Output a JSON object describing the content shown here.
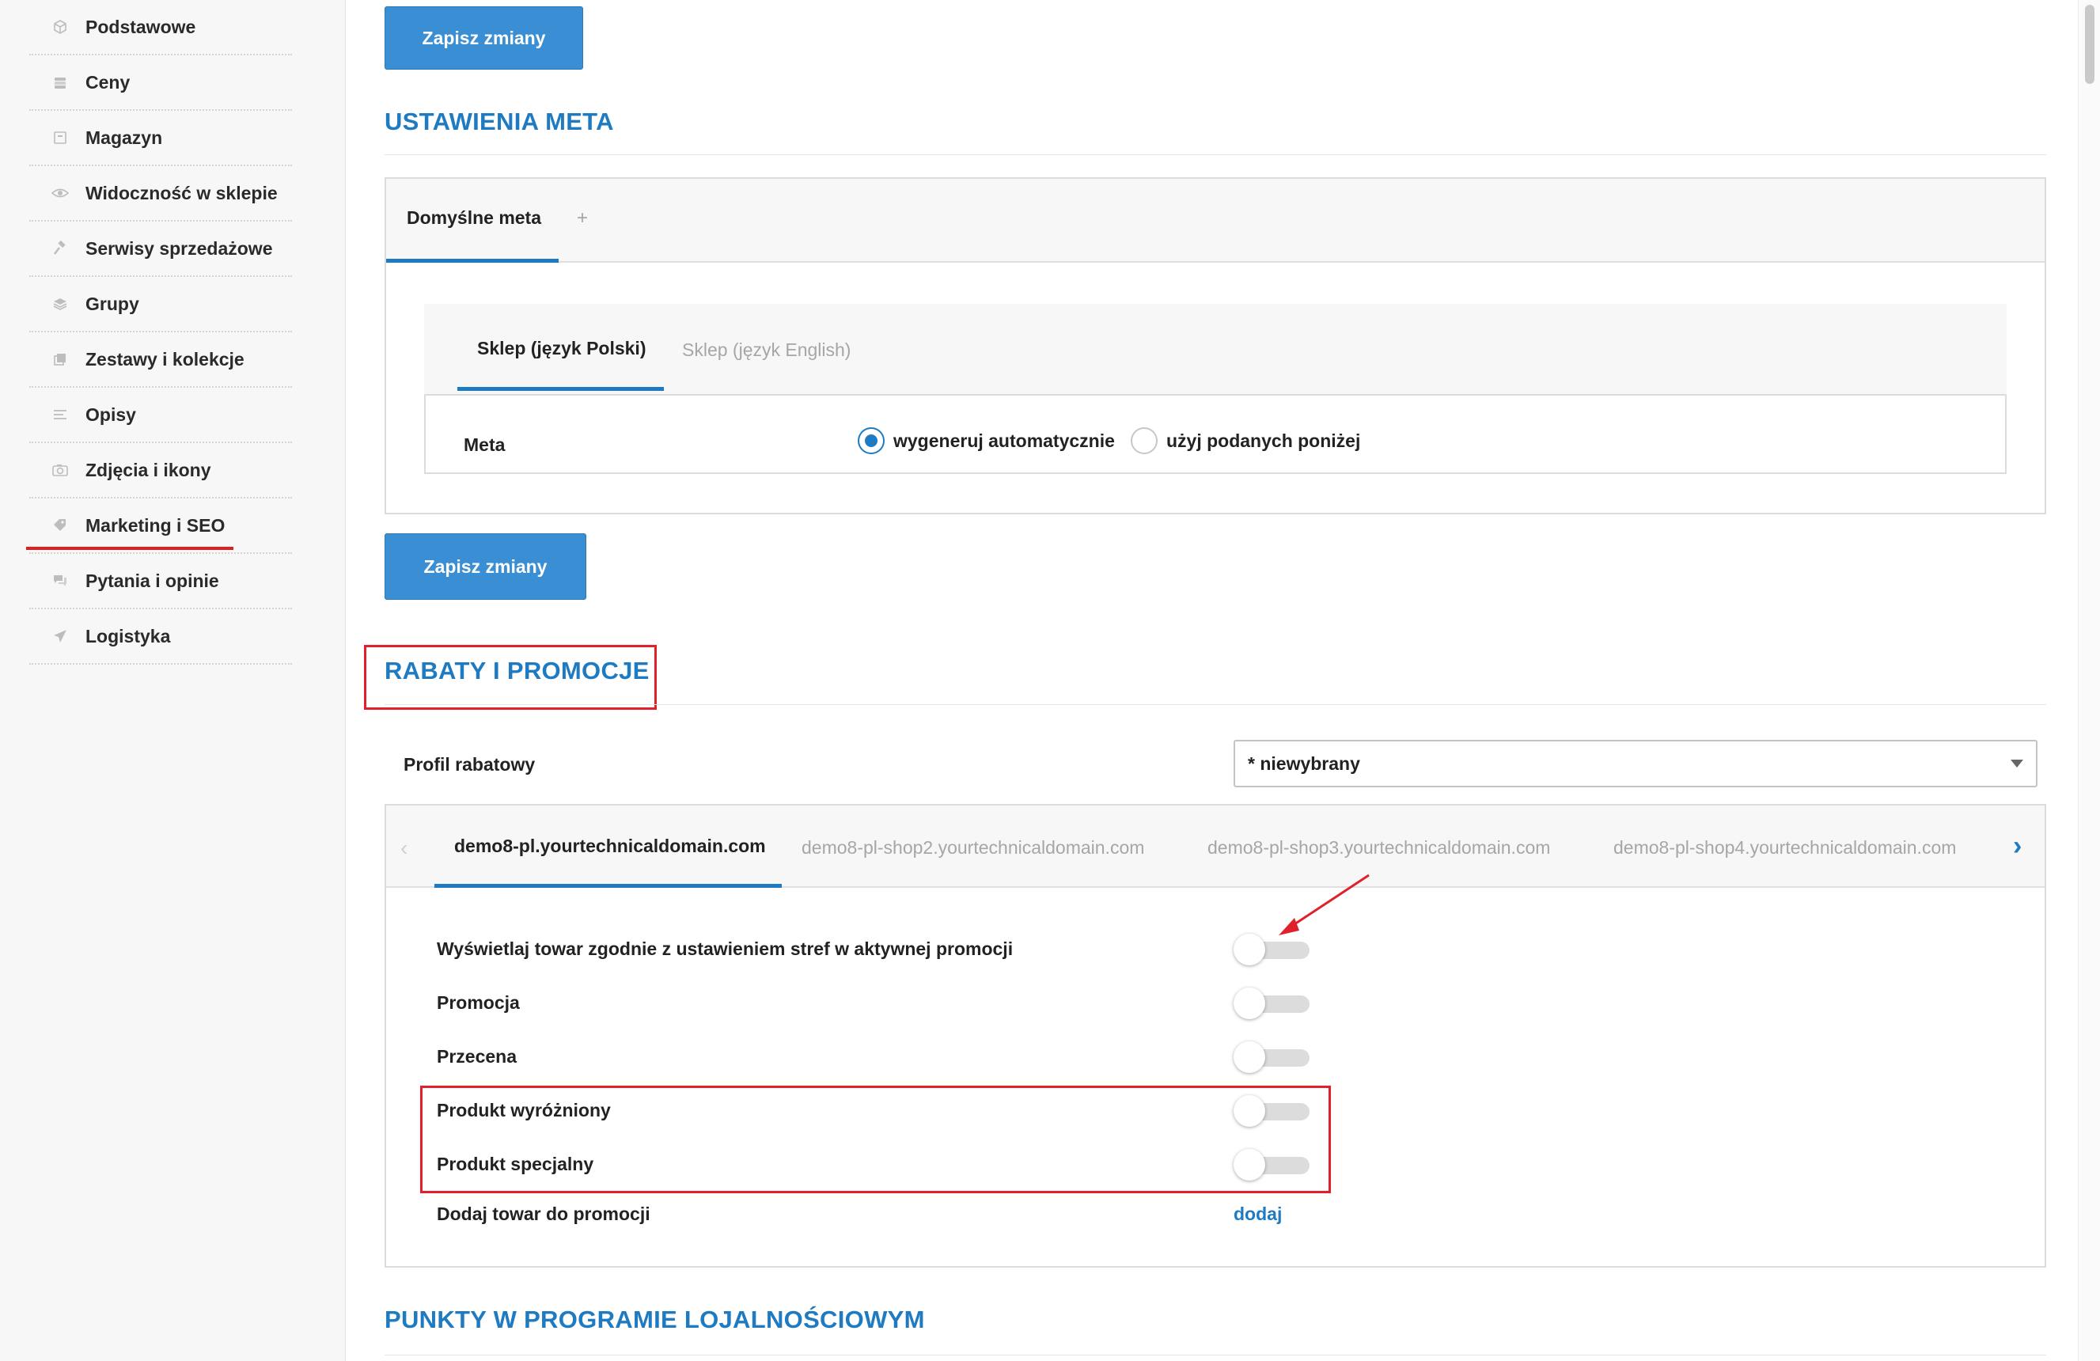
{
  "sidebar": {
    "items": [
      {
        "label": "Podstawowe",
        "icon": "cube-icon"
      },
      {
        "label": "Ceny",
        "icon": "coins-icon"
      },
      {
        "label": "Magazyn",
        "icon": "box-icon"
      },
      {
        "label": "Widoczność w sklepie",
        "icon": "eye-icon"
      },
      {
        "label": "Serwisy sprzedażowe",
        "icon": "gavel-icon"
      },
      {
        "label": "Grupy",
        "icon": "layers-icon"
      },
      {
        "label": "Zestawy i kolekcje",
        "icon": "copy-icon"
      },
      {
        "label": "Opisy",
        "icon": "lines-icon"
      },
      {
        "label": "Zdjęcia i ikony",
        "icon": "camera-icon"
      },
      {
        "label": "Marketing i SEO",
        "icon": "tag-icon"
      },
      {
        "label": "Pytania i opinie",
        "icon": "comments-icon"
      },
      {
        "label": "Logistyka",
        "icon": "paper-plane-icon"
      }
    ],
    "active": "Marketing i SEO"
  },
  "buttons": {
    "save_top": "Zapisz zmiany",
    "save_meta": "Zapisz zmiany"
  },
  "meta_section": {
    "title": "USTAWIENIA META",
    "tabs": {
      "default": "Domyślne meta",
      "add": "+"
    },
    "lang_tabs": {
      "pl": "Sklep (język Polski)",
      "en": "Sklep (język English)"
    },
    "meta_label": "Meta",
    "radio_auto": "wygeneruj automatycznie",
    "radio_manual": "użyj podanych poniżej",
    "selected": "wygeneruj automatycznie"
  },
  "promo_section": {
    "title": "RABATY I PROMOCJE",
    "profile_label": "Profil rabatowy",
    "profile_value": "* niewybrany",
    "shop_tabs": [
      "demo8-pl.yourtechnicaldomain.com",
      "demo8-pl-shop2.yourtechnicaldomain.com",
      "demo8-pl-shop3.yourtechnicaldomain.com",
      "demo8-pl-shop4.yourtechnicaldomain.com"
    ],
    "toggles": [
      {
        "label": "Wyświetlaj towar zgodnie z ustawieniem stref w aktywnej promocji",
        "on": false
      },
      {
        "label": "Promocja",
        "on": false
      },
      {
        "label": "Przecena",
        "on": false
      },
      {
        "label": "Produkt wyróżniony",
        "on": false
      },
      {
        "label": "Produkt specjalny",
        "on": false
      }
    ],
    "add_label": "Dodaj towar do promocji",
    "add_link": "dodaj"
  },
  "loyalty_section": {
    "title": "PUNKTY W PROGRAMIE LOJALNOŚCIOWYM"
  },
  "colors": {
    "accent": "#1e7bc2",
    "button": "#3a8ed4",
    "annotation": "#e0202a"
  }
}
